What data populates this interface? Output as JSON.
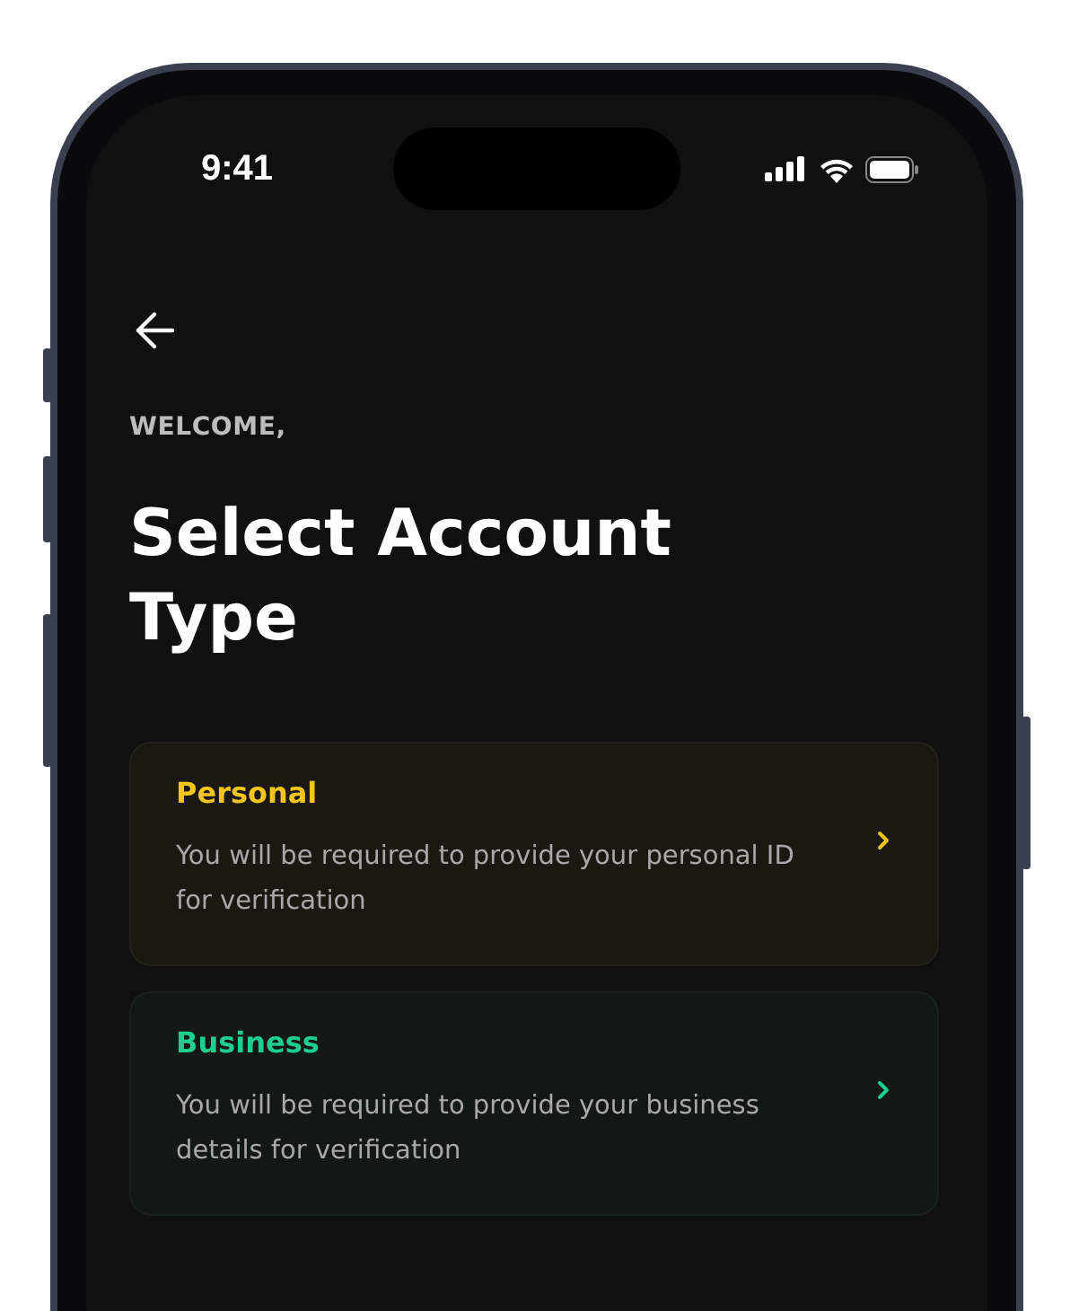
{
  "status_bar": {
    "time": "9:41"
  },
  "greeting": "WELCOME,",
  "title": "Select Account Type",
  "account_types": [
    {
      "name": "Personal",
      "description": "You will be required to provide your personal ID for verification",
      "color": "#f5c518"
    },
    {
      "name": "Business",
      "description": "You will be required to provide your business details for verification",
      "color": "#1ccf8e"
    }
  ]
}
